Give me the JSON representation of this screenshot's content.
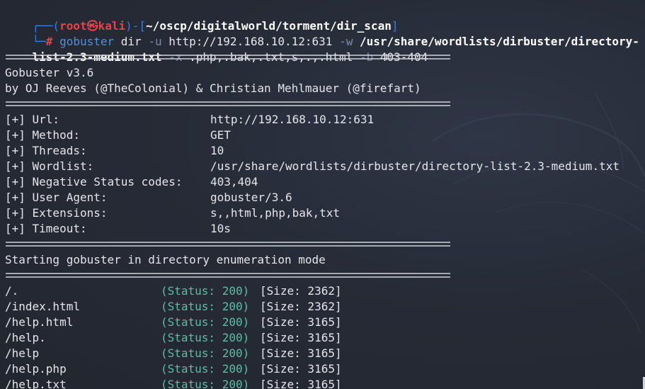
{
  "prompt": {
    "open_paren": "┌──(",
    "user_host_user": "root",
    "user_host_sep": "㉿",
    "user_host_host": "kali",
    "close_paren": ")-[",
    "cwd": "~/oscp/digitalworld/torment/dir_scan",
    "close_bracket": "]",
    "line2_prefix": "└─",
    "hash": "#"
  },
  "command": {
    "program": "gobuster",
    "sub": "dir",
    "flag_u": "-u",
    "url": "http://192.168.10.12:631",
    "flag_w": "-w",
    "wordlist_part1": "/usr/share/wordlists/dirbuster/directory-",
    "wordlist_part2": "list-2.3-medium.txt",
    "flag_x": "-x",
    "extensions": ".php,.bak,.txt,s,.,.html",
    "flag_b": "-b",
    "blacklist": "403-404"
  },
  "banner": {
    "line1": "Gobuster v3.6",
    "line2": "by OJ Reeves (@TheColonial) & Christian Mehlmauer (@firefart)"
  },
  "config": [
    {
      "label": "[+] Url:",
      "value": "http://192.168.10.12:631"
    },
    {
      "label": "[+] Method:",
      "value": "GET"
    },
    {
      "label": "[+] Threads:",
      "value": "10"
    },
    {
      "label": "[+] Wordlist:",
      "value": "/usr/share/wordlists/dirbuster/directory-list-2.3-medium.txt"
    },
    {
      "label": "[+] Negative Status codes:",
      "value": "403,404"
    },
    {
      "label": "[+] User Agent:",
      "value": "gobuster/3.6"
    },
    {
      "label": "[+] Extensions:",
      "value": "s,,html,php,bak,txt"
    },
    {
      "label": "[+] Timeout:",
      "value": "10s"
    }
  ],
  "starting_message": "Starting gobuster in directory enumeration mode",
  "results": [
    {
      "path": "/.",
      "status": "(Status: 200)",
      "size": "[Size: 2362]"
    },
    {
      "path": "/index.html",
      "status": "(Status: 200)",
      "size": "[Size: 2362]"
    },
    {
      "path": "/help.html",
      "status": "(Status: 200)",
      "size": "[Size: 3165]"
    },
    {
      "path": "/help.",
      "status": "(Status: 200)",
      "size": "[Size: 3165]"
    },
    {
      "path": "/help",
      "status": "(Status: 200)",
      "size": "[Size: 3165]"
    },
    {
      "path": "/help.php",
      "status": "(Status: 200)",
      "size": "[Size: 3165]"
    },
    {
      "path": "/help.txt",
      "status": "(Status: 200)",
      "size": "[Size: 3165]"
    }
  ],
  "colors": {
    "background": "#252a36",
    "prompt_blue": "#3e7dd8",
    "prompt_red": "#e4434a",
    "status_green": "#5bbfa3",
    "flag_gray": "#7e8aa8",
    "text": "#e4e6eb"
  }
}
